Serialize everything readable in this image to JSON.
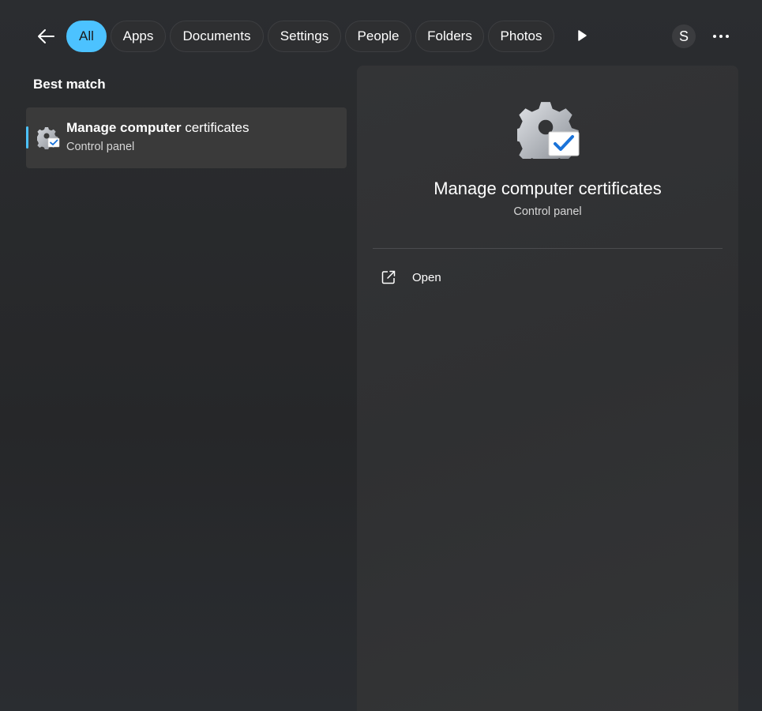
{
  "filters": {
    "back_icon": "arrow-left-icon",
    "chips": [
      {
        "label": "All",
        "active": true
      },
      {
        "label": "Apps",
        "active": false
      },
      {
        "label": "Documents",
        "active": false
      },
      {
        "label": "Settings",
        "active": false
      },
      {
        "label": "People",
        "active": false
      },
      {
        "label": "Folders",
        "active": false
      },
      {
        "label": "Photos",
        "active": false
      }
    ],
    "more_filters_icon": "play-arrow-icon",
    "avatar_initial": "S",
    "more_options_icon": "ellipsis-icon",
    "accent_color": "#4cc2ff"
  },
  "best_match": {
    "section_title": "Best match",
    "item": {
      "title_bold": "Manage computer",
      "title_rest": " certificates",
      "subtitle": "Control panel",
      "icon": "gear-certificate-icon"
    }
  },
  "preview": {
    "title": "Manage computer certificates",
    "subtitle": "Control panel",
    "icon": "gear-certificate-icon",
    "actions": [
      {
        "label": "Open",
        "icon": "open-external-icon"
      }
    ]
  }
}
